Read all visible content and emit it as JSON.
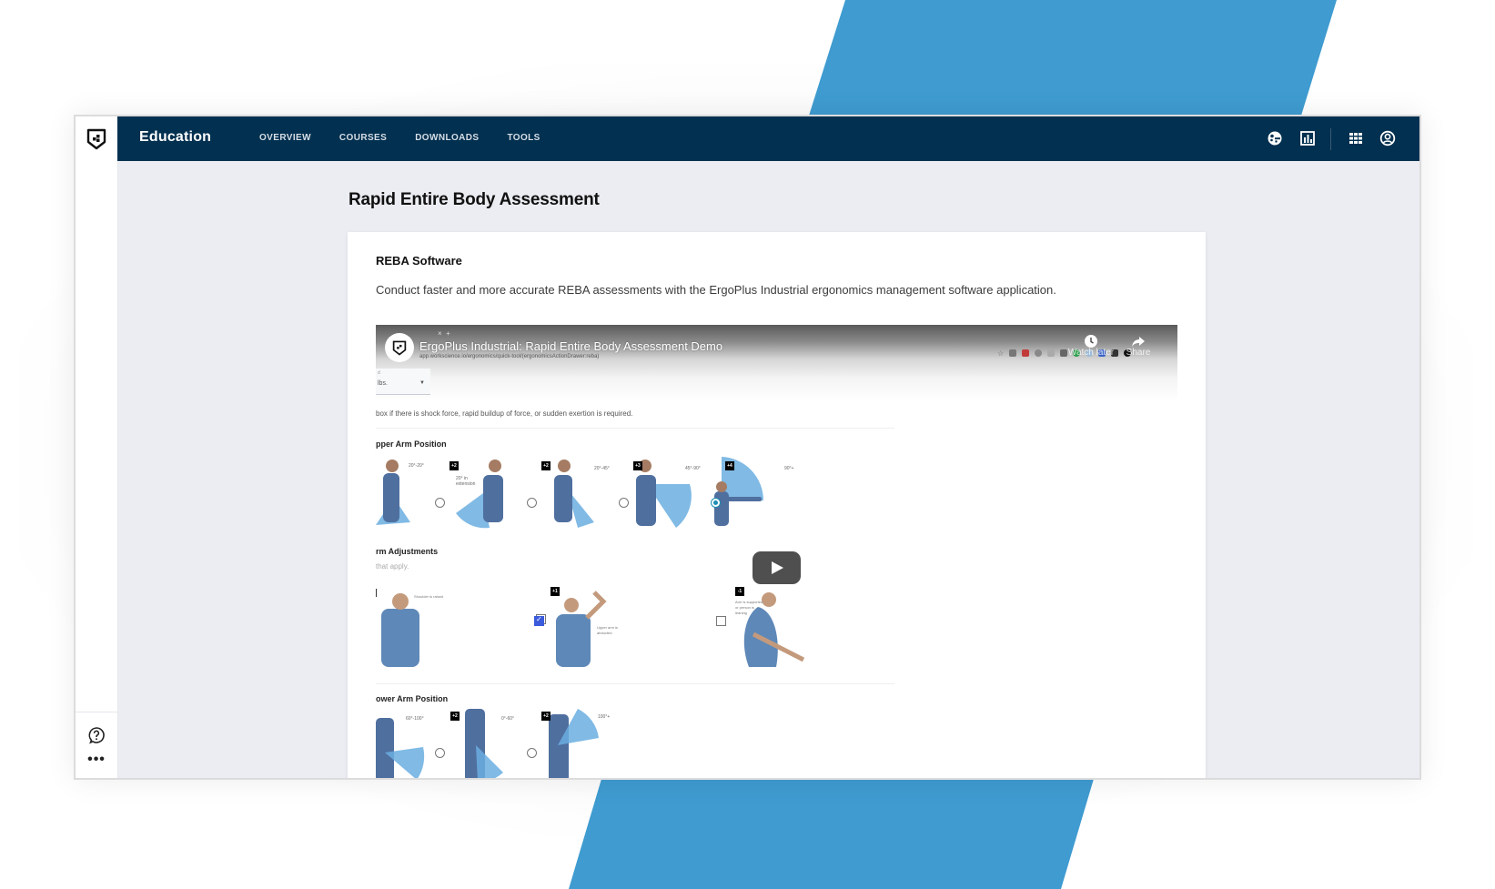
{
  "header": {
    "app_title": "Education",
    "nav": [
      {
        "label": "OVERVIEW"
      },
      {
        "label": "COURSES"
      },
      {
        "label": "DOWNLOADS"
      },
      {
        "label": "TOOLS"
      }
    ],
    "icons": [
      "palette-icon",
      "chart-icon",
      "apps-grid-icon",
      "user-account-icon"
    ]
  },
  "sidebar": {
    "logo": "shield-logo-icon",
    "bottom_icons": [
      "help-icon",
      "more-icon"
    ],
    "more_label": "•••"
  },
  "page": {
    "title": "Rapid Entire Body Assessment"
  },
  "card": {
    "title": "REBA Software",
    "description": "Conduct faster and more accurate REBA assessments with the ErgoPlus Industrial ergonomics management software application."
  },
  "video": {
    "title": "ErgoPlus Industrial: Rapid Entire Body Assessment Demo",
    "url": "app.workscience.io/ergonomics/quick-tool/(ergonomicsActionDrawer:reba)",
    "watch_later_label": "Watch later",
    "share_label": "Share",
    "dropdown_value": "lbs.",
    "instruction": "box if there is shock force, rapid buildup of force, or sudden exertion is required.",
    "sections": {
      "upper_arm": {
        "heading": "pper Arm Position",
        "options": [
          {
            "angle": "20°-20°",
            "badge": "",
            "selected": false
          },
          {
            "angle": "20° in extension",
            "badge": "+2",
            "selected": false
          },
          {
            "angle": "20°-45°",
            "badge": "+2",
            "selected": false
          },
          {
            "angle": "45°-90°",
            "badge": "+3",
            "selected": true
          },
          {
            "angle": "90°+",
            "badge": "+4",
            "selected": false
          }
        ]
      },
      "arm_adjustments": {
        "heading": "rm Adjustments",
        "subheading": "that apply.",
        "options": [
          {
            "caption": "Shoulder is raised",
            "badge": "",
            "checked": false
          },
          {
            "caption": "Upper arm is abducted",
            "badge": "+1",
            "checked": true
          },
          {
            "caption": "Arm is supported or person is leaning",
            "badge": "-1",
            "checked": false
          }
        ]
      },
      "lower_arm": {
        "heading": "ower Arm Position",
        "options": [
          {
            "angle": "60°-100°",
            "badge": ""
          },
          {
            "angle": "0°-60°",
            "badge": "+2"
          },
          {
            "angle": "100°+",
            "badge": "+2"
          }
        ]
      }
    }
  },
  "colors": {
    "header_bg": "#023050",
    "accent_blue": "#3f9bd0",
    "page_bg": "#ebedf2"
  }
}
